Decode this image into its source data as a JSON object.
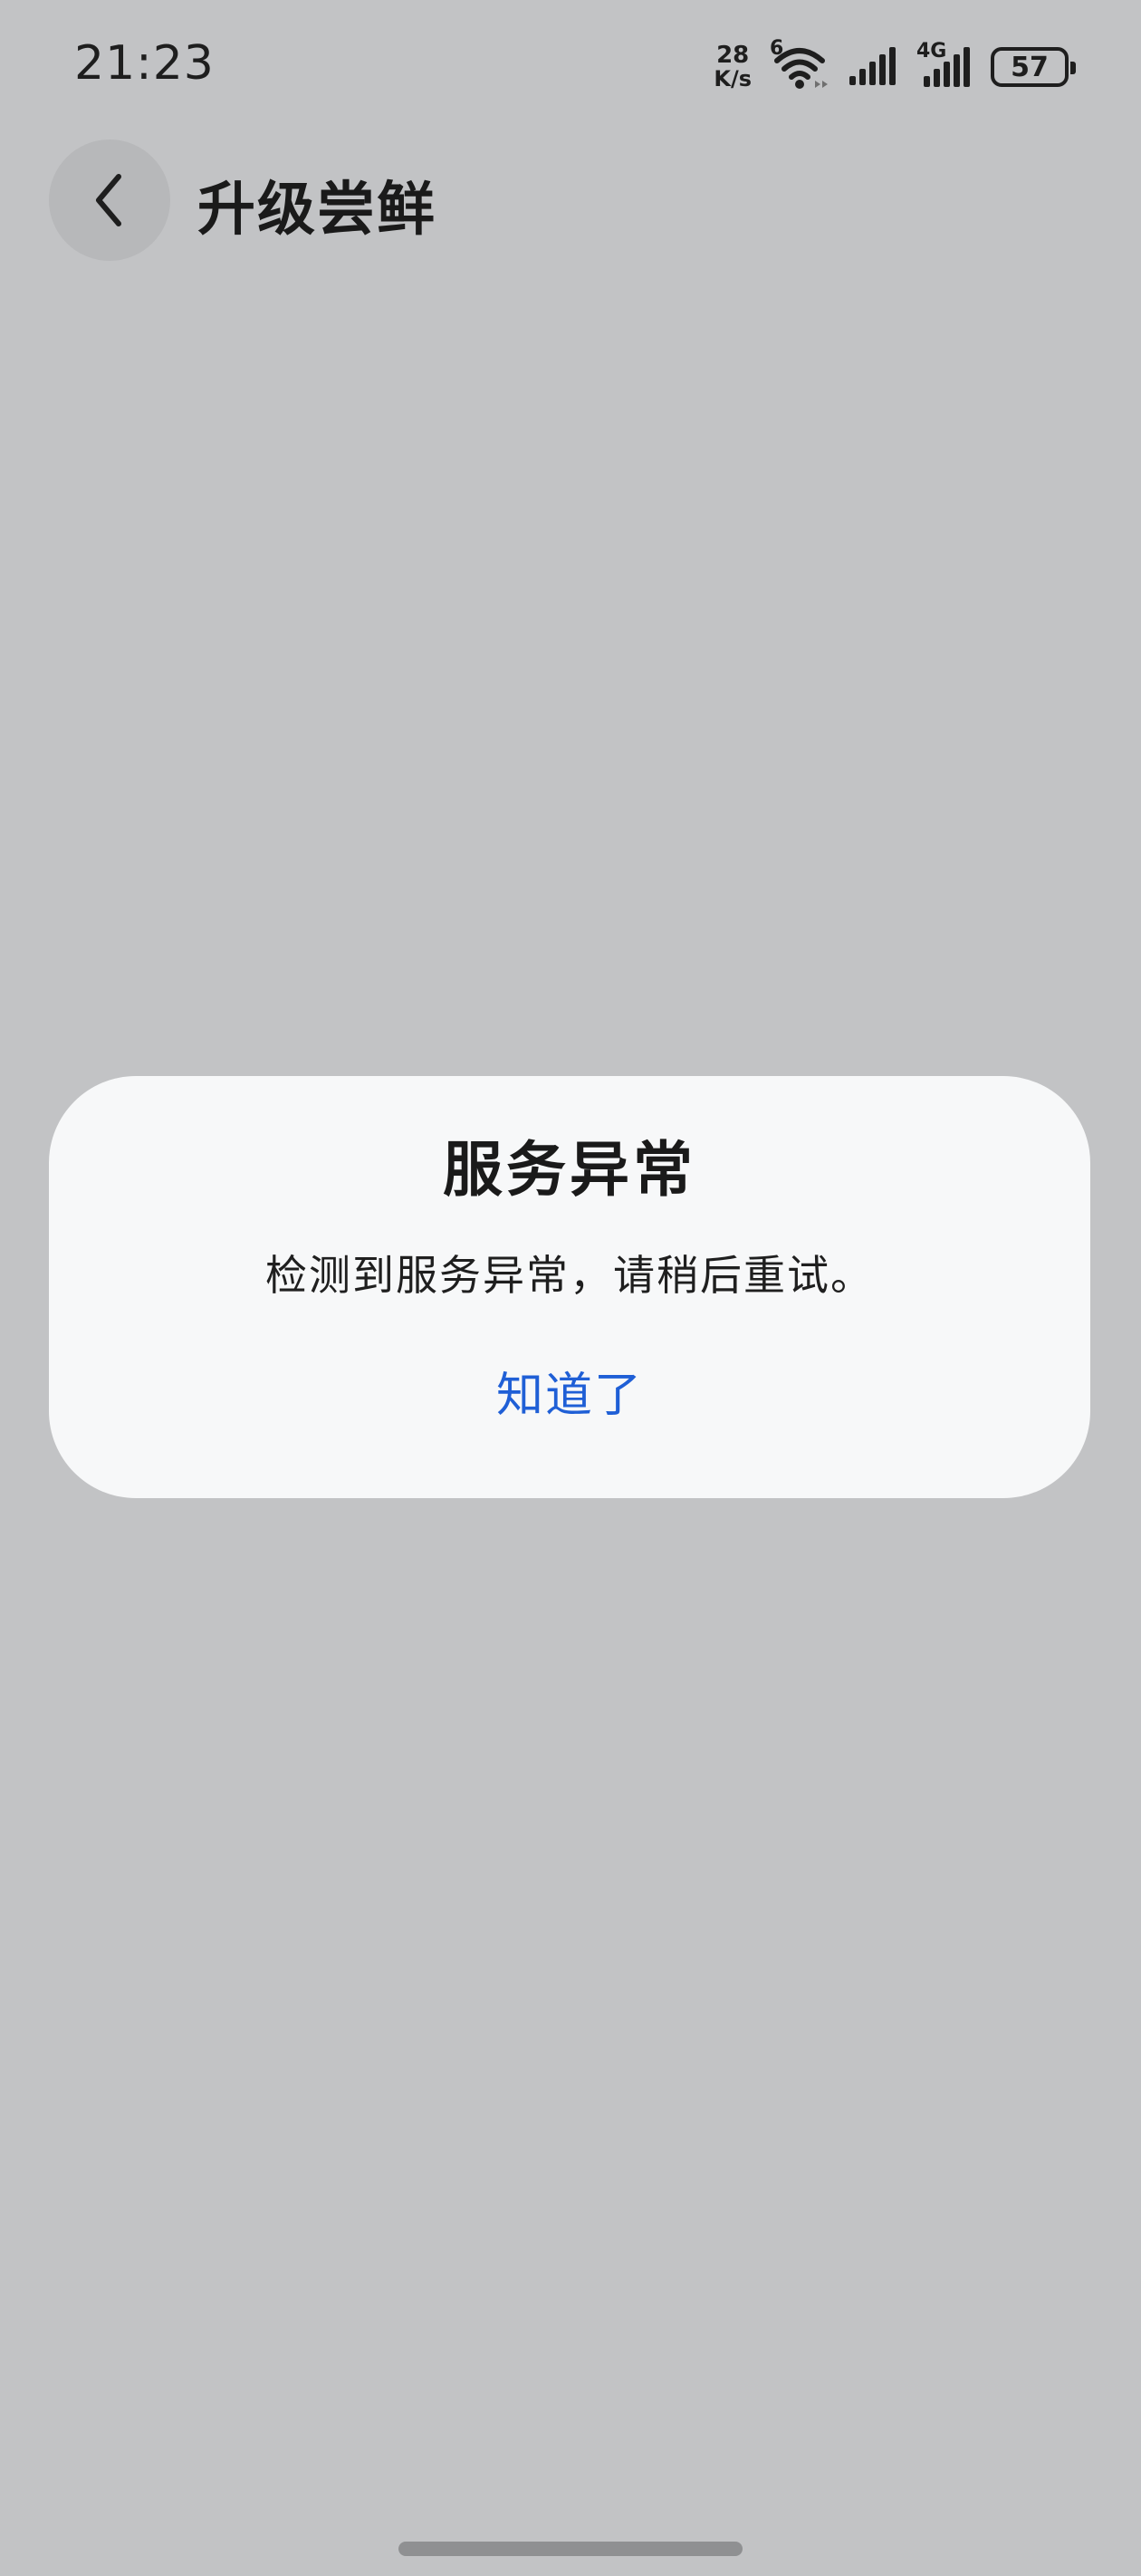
{
  "status_bar": {
    "time": "21:23",
    "net_speed_value": "28",
    "net_speed_unit": "K/s",
    "wifi_badge": "6",
    "cell_badge": "4G",
    "battery_level": "57"
  },
  "header": {
    "title": "升级尝鲜"
  },
  "dialog": {
    "title": "服务异常",
    "message": "检测到服务异常，请稍后重试。",
    "confirm_label": "知道了"
  },
  "colors": {
    "background": "#c2c3c5",
    "dialog_bg": "#f7f8f9",
    "accent": "#1f5fd6"
  }
}
